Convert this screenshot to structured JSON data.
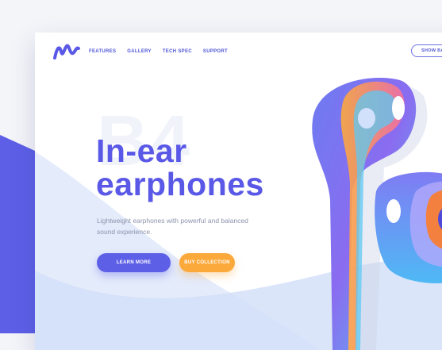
{
  "nav": {
    "items": [
      {
        "label": "FEATURES"
      },
      {
        "label": "GALLERY"
      },
      {
        "label": "TECH SPEC"
      },
      {
        "label": "SUPPORT"
      }
    ],
    "show_button": "SHOW BAG"
  },
  "hero": {
    "ghost_text": "B4",
    "title_line1": "In-ear",
    "title_line2": "earphones",
    "subtitle": "Lightweight earphones with powerful and balanced sound experience.",
    "learn_more": "LEARN MORE",
    "buy_collection": "BUY COLLECTION"
  },
  "colors": {
    "accent": "#5a58e6",
    "secondary": "#fca93c",
    "background_band": "#5d5fe7"
  },
  "icons": {
    "logo": "brand-logo-m"
  }
}
